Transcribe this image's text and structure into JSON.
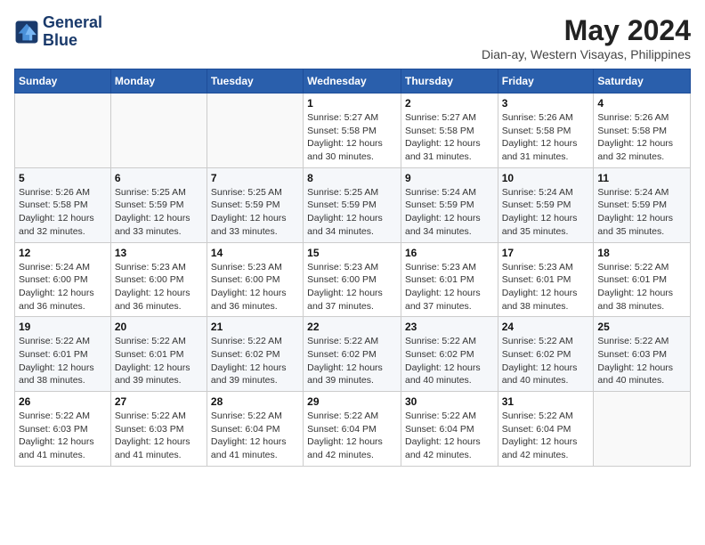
{
  "logo": {
    "line1": "General",
    "line2": "Blue"
  },
  "title": "May 2024",
  "location": "Dian-ay, Western Visayas, Philippines",
  "days_header": [
    "Sunday",
    "Monday",
    "Tuesday",
    "Wednesday",
    "Thursday",
    "Friday",
    "Saturday"
  ],
  "weeks": [
    [
      {
        "day": "",
        "info": ""
      },
      {
        "day": "",
        "info": ""
      },
      {
        "day": "",
        "info": ""
      },
      {
        "day": "1",
        "info": "Sunrise: 5:27 AM\nSunset: 5:58 PM\nDaylight: 12 hours and 30 minutes."
      },
      {
        "day": "2",
        "info": "Sunrise: 5:27 AM\nSunset: 5:58 PM\nDaylight: 12 hours and 31 minutes."
      },
      {
        "day": "3",
        "info": "Sunrise: 5:26 AM\nSunset: 5:58 PM\nDaylight: 12 hours and 31 minutes."
      },
      {
        "day": "4",
        "info": "Sunrise: 5:26 AM\nSunset: 5:58 PM\nDaylight: 12 hours and 32 minutes."
      }
    ],
    [
      {
        "day": "5",
        "info": "Sunrise: 5:26 AM\nSunset: 5:58 PM\nDaylight: 12 hours and 32 minutes."
      },
      {
        "day": "6",
        "info": "Sunrise: 5:25 AM\nSunset: 5:59 PM\nDaylight: 12 hours and 33 minutes."
      },
      {
        "day": "7",
        "info": "Sunrise: 5:25 AM\nSunset: 5:59 PM\nDaylight: 12 hours and 33 minutes."
      },
      {
        "day": "8",
        "info": "Sunrise: 5:25 AM\nSunset: 5:59 PM\nDaylight: 12 hours and 34 minutes."
      },
      {
        "day": "9",
        "info": "Sunrise: 5:24 AM\nSunset: 5:59 PM\nDaylight: 12 hours and 34 minutes."
      },
      {
        "day": "10",
        "info": "Sunrise: 5:24 AM\nSunset: 5:59 PM\nDaylight: 12 hours and 35 minutes."
      },
      {
        "day": "11",
        "info": "Sunrise: 5:24 AM\nSunset: 5:59 PM\nDaylight: 12 hours and 35 minutes."
      }
    ],
    [
      {
        "day": "12",
        "info": "Sunrise: 5:24 AM\nSunset: 6:00 PM\nDaylight: 12 hours and 36 minutes."
      },
      {
        "day": "13",
        "info": "Sunrise: 5:23 AM\nSunset: 6:00 PM\nDaylight: 12 hours and 36 minutes."
      },
      {
        "day": "14",
        "info": "Sunrise: 5:23 AM\nSunset: 6:00 PM\nDaylight: 12 hours and 36 minutes."
      },
      {
        "day": "15",
        "info": "Sunrise: 5:23 AM\nSunset: 6:00 PM\nDaylight: 12 hours and 37 minutes."
      },
      {
        "day": "16",
        "info": "Sunrise: 5:23 AM\nSunset: 6:01 PM\nDaylight: 12 hours and 37 minutes."
      },
      {
        "day": "17",
        "info": "Sunrise: 5:23 AM\nSunset: 6:01 PM\nDaylight: 12 hours and 38 minutes."
      },
      {
        "day": "18",
        "info": "Sunrise: 5:22 AM\nSunset: 6:01 PM\nDaylight: 12 hours and 38 minutes."
      }
    ],
    [
      {
        "day": "19",
        "info": "Sunrise: 5:22 AM\nSunset: 6:01 PM\nDaylight: 12 hours and 38 minutes."
      },
      {
        "day": "20",
        "info": "Sunrise: 5:22 AM\nSunset: 6:01 PM\nDaylight: 12 hours and 39 minutes."
      },
      {
        "day": "21",
        "info": "Sunrise: 5:22 AM\nSunset: 6:02 PM\nDaylight: 12 hours and 39 minutes."
      },
      {
        "day": "22",
        "info": "Sunrise: 5:22 AM\nSunset: 6:02 PM\nDaylight: 12 hours and 39 minutes."
      },
      {
        "day": "23",
        "info": "Sunrise: 5:22 AM\nSunset: 6:02 PM\nDaylight: 12 hours and 40 minutes."
      },
      {
        "day": "24",
        "info": "Sunrise: 5:22 AM\nSunset: 6:02 PM\nDaylight: 12 hours and 40 minutes."
      },
      {
        "day": "25",
        "info": "Sunrise: 5:22 AM\nSunset: 6:03 PM\nDaylight: 12 hours and 40 minutes."
      }
    ],
    [
      {
        "day": "26",
        "info": "Sunrise: 5:22 AM\nSunset: 6:03 PM\nDaylight: 12 hours and 41 minutes."
      },
      {
        "day": "27",
        "info": "Sunrise: 5:22 AM\nSunset: 6:03 PM\nDaylight: 12 hours and 41 minutes."
      },
      {
        "day": "28",
        "info": "Sunrise: 5:22 AM\nSunset: 6:04 PM\nDaylight: 12 hours and 41 minutes."
      },
      {
        "day": "29",
        "info": "Sunrise: 5:22 AM\nSunset: 6:04 PM\nDaylight: 12 hours and 42 minutes."
      },
      {
        "day": "30",
        "info": "Sunrise: 5:22 AM\nSunset: 6:04 PM\nDaylight: 12 hours and 42 minutes."
      },
      {
        "day": "31",
        "info": "Sunrise: 5:22 AM\nSunset: 6:04 PM\nDaylight: 12 hours and 42 minutes."
      },
      {
        "day": "",
        "info": ""
      }
    ]
  ]
}
